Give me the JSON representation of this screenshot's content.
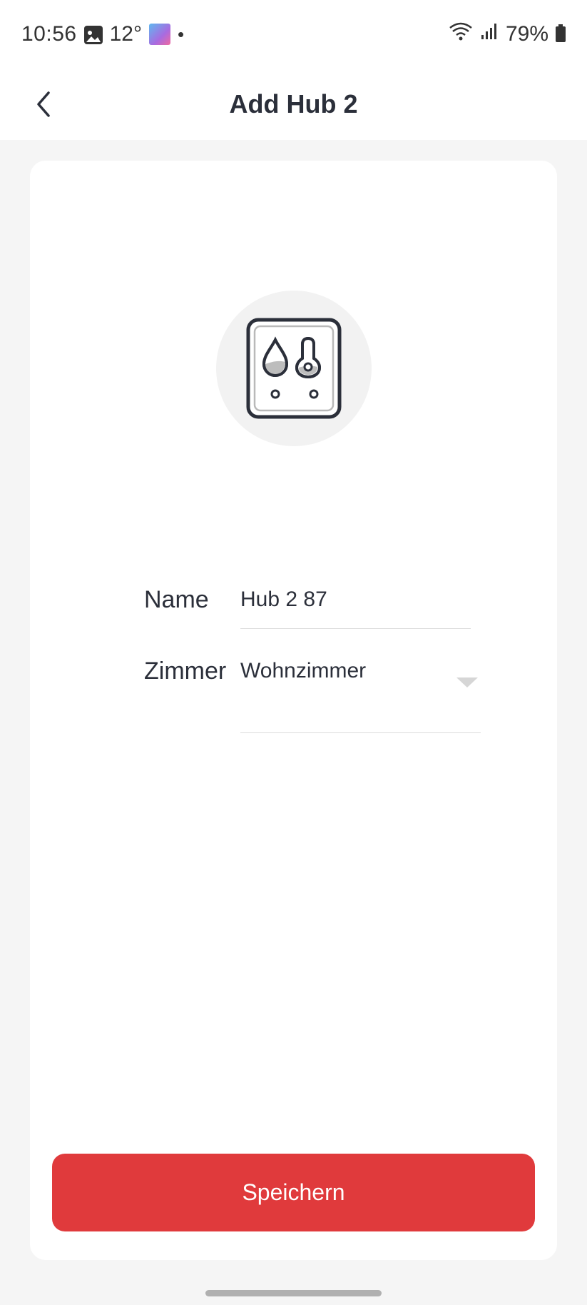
{
  "status_bar": {
    "time": "10:56",
    "temperature": "12°",
    "dot": "•",
    "battery": "79%",
    "icons": [
      "gallery-icon",
      "weather-tile-icon",
      "wifi-icon",
      "signal-icon",
      "battery-icon"
    ]
  },
  "header": {
    "title": "Add Hub 2",
    "back_icon": "chevron-left-icon"
  },
  "device": {
    "icon": "hub-2-device-icon"
  },
  "form": {
    "name_label": "Name",
    "name_value": "Hub 2 87",
    "room_label": "Zimmer",
    "room_value": "Wohnzimmer"
  },
  "actions": {
    "save_label": "Speichern"
  },
  "colors": {
    "accent": "#e03a3c",
    "text": "#2b2f3a",
    "background": "#f5f5f5",
    "card": "#ffffff"
  }
}
